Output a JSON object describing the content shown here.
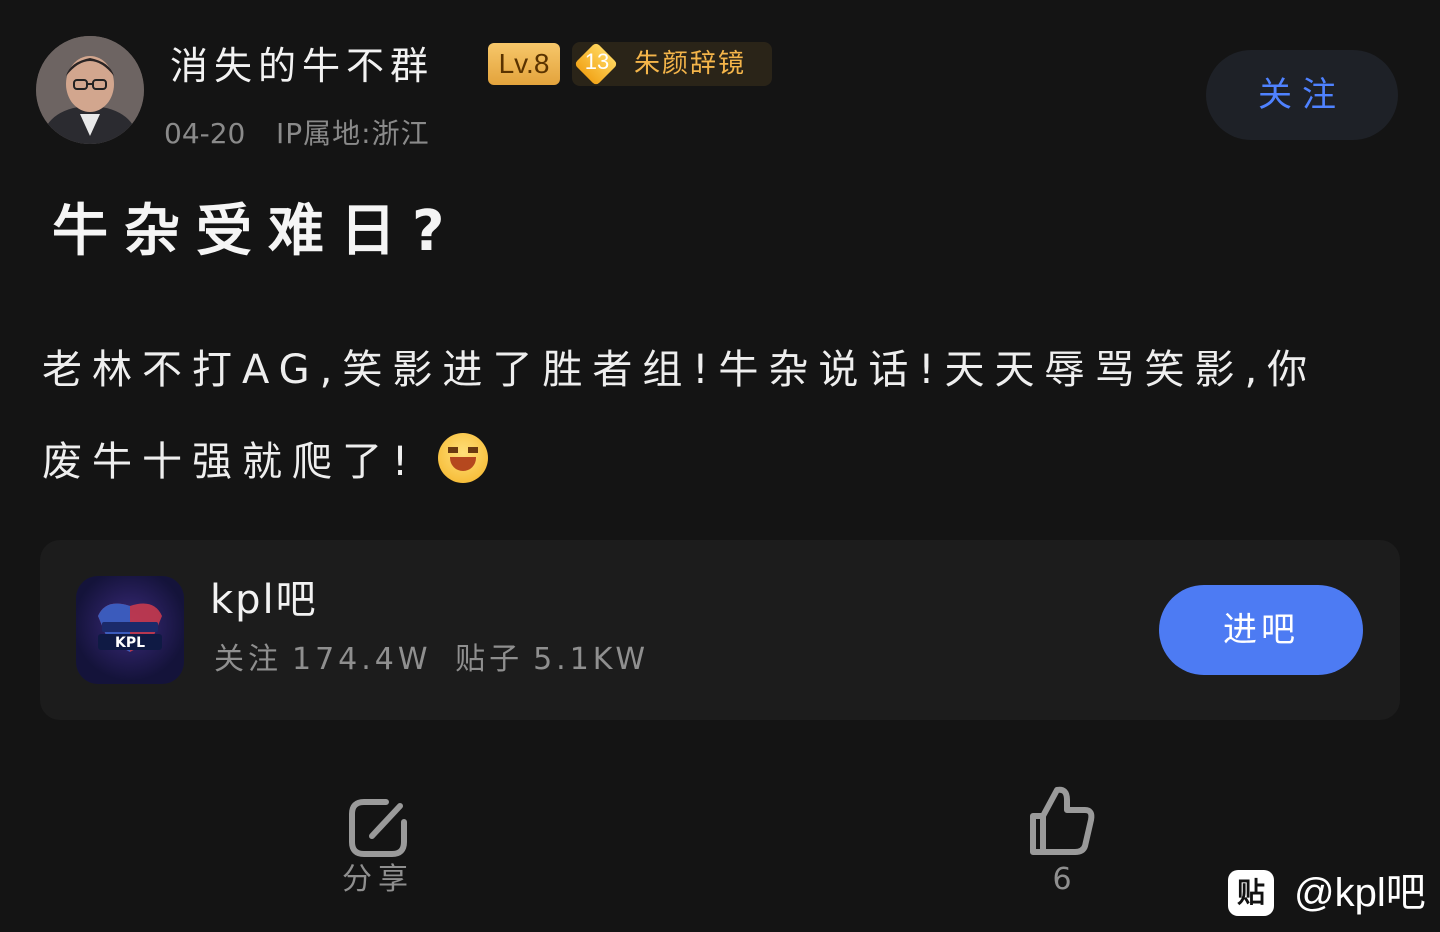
{
  "author": {
    "name": "消失的牛不群",
    "level_badge": "Lv.8",
    "honor_level": "13",
    "honor_title": "朱颜辞镜",
    "date": "04-20",
    "ip_location": "IP属地:浙江",
    "follow_label": "关注"
  },
  "post": {
    "title": "牛杂受难日?",
    "body": "老林不打AG,笑影进了胜者组!牛杂说话!天天辱骂笑影,你废牛十强就爬了!",
    "emoji": "laughing-emoji"
  },
  "forum": {
    "name": "kpl吧",
    "followers_label": "关注",
    "followers": "174.4W",
    "posts_label": "贴子",
    "posts": "5.1KW",
    "enter_label": "进吧",
    "logo_icon": "kpl-logo-icon"
  },
  "actions": {
    "share_label": "分享",
    "like_count": "6"
  },
  "watermark": {
    "icon_text": "贴",
    "text": "@kpl吧"
  },
  "colors": {
    "background": "#141414",
    "card": "#1c1c1c",
    "accent": "#4d7bf3",
    "follow_text": "#4f82ff",
    "level_badge": "#f2b552",
    "honor_title": "#f4b54a",
    "muted_text": "#8f8f8f"
  }
}
